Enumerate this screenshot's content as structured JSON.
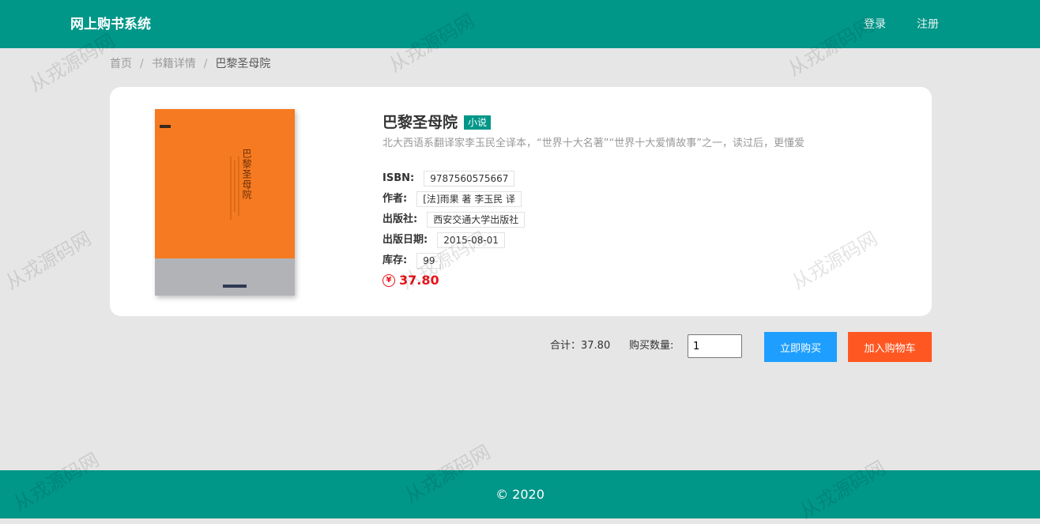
{
  "header": {
    "title": "网上购书系统",
    "login_label": "登录",
    "register_label": "注册"
  },
  "breadcrumb": {
    "home": "首页",
    "detail": "书籍详情",
    "current": "巴黎圣母院",
    "separator": "/"
  },
  "book": {
    "cover_title": "巴黎圣母院",
    "title": "巴黎圣母院",
    "category": "小说",
    "description": "北大西语系翻译家李玉民全译本，“世界十大名著”“世界十大爱情故事”之一，读过后，更懂爱",
    "isbn_label": "ISBN:",
    "isbn": "9787560575667",
    "author_label": "作者:",
    "author": "[法]雨果 著 李玉民 译",
    "publisher_label": "出版社:",
    "publisher": "西安交通大学出版社",
    "pub_date_label": "出版日期:",
    "pub_date": "2015-08-01",
    "stock_label": "库存:",
    "stock": "99",
    "price_symbol": "¥",
    "price": "37.80"
  },
  "purchase": {
    "total_label": "合计：37.80",
    "qty_label": "购买数量:",
    "qty_value": "1",
    "buy_label": "立即购买",
    "cart_label": "加入购物车"
  },
  "footer": {
    "copyright": "© 2020"
  },
  "watermark": "从戎源码网",
  "colors": {
    "primary": "#009688",
    "buy": "#1e9fff",
    "cart": "#ff5722",
    "price": "#e8141b"
  }
}
